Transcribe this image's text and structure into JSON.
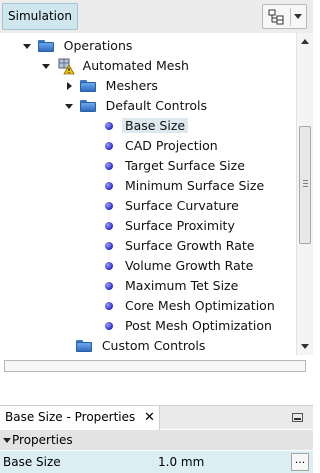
{
  "header": {
    "tab_label": "Simulation",
    "toolbar_icon": "tree-view-icon",
    "toolbar_dropdown_icon": "chevron-down-icon"
  },
  "tree": {
    "operations": "Operations",
    "automated_mesh": "Automated Mesh",
    "meshers": "Meshers",
    "default_controls": "Default Controls",
    "items": [
      "Base Size",
      "CAD Projection",
      "Target Surface Size",
      "Minimum Surface Size",
      "Surface Curvature",
      "Surface Proximity",
      "Surface Growth Rate",
      "Volume Growth Rate",
      "Maximum Tet Size",
      "Core Mesh Optimization",
      "Post Mesh Optimization"
    ],
    "selected_item": "Base Size",
    "custom_controls": "Custom Controls"
  },
  "properties": {
    "tab_title": "Base Size - Properties",
    "close_glyph": "✕",
    "group": "Properties",
    "row_key": "Base Size",
    "row_value": "1.0 mm",
    "more_glyph": "..."
  },
  "colors": {
    "selection": "#dde9ef",
    "sim_tab": "#cfe6ee",
    "property_row": "#dbeef4"
  }
}
